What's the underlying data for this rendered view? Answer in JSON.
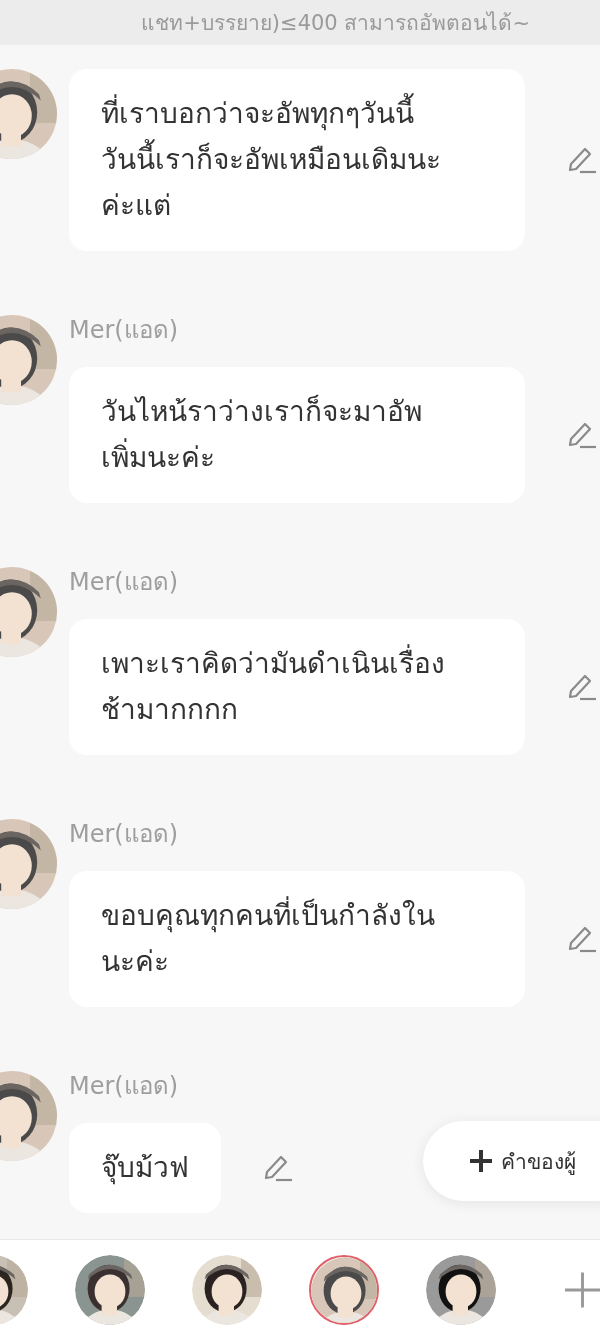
{
  "banner": {
    "text": "แชท+บรรยาย)≤400 สามารถอัพตอนได้~"
  },
  "messages": [
    {
      "text": "ที่เราบอกว่าจะอัพทุกๆวันนี้\nวันนี้เราก็จะอัพเหมือนเดิมนะ\nค่ะแต่"
    },
    {
      "name": "Mer(แอด)",
      "text": "วันไหน้ราว่างเราก็จะมาอัพ\nเพิ่มนะค่ะ"
    },
    {
      "name": "Mer(แอด)",
      "text": "เพาะเราคิดว่ามันดำเนินเรื่อง\nช้ามากกกก"
    },
    {
      "name": "Mer(แอด)",
      "text": "ขอบคุณทุกคนที่เป็นกำลังใน\nนะค่ะ"
    },
    {
      "name": "Mer(แอด)",
      "text": "จุ๊บม้วฟ"
    }
  ],
  "floating_button": {
    "label": "คำของผู้"
  },
  "characters": [
    {
      "selected": false
    },
    {
      "selected": false
    },
    {
      "selected": false
    },
    {
      "selected": true
    },
    {
      "selected": false
    }
  ]
}
